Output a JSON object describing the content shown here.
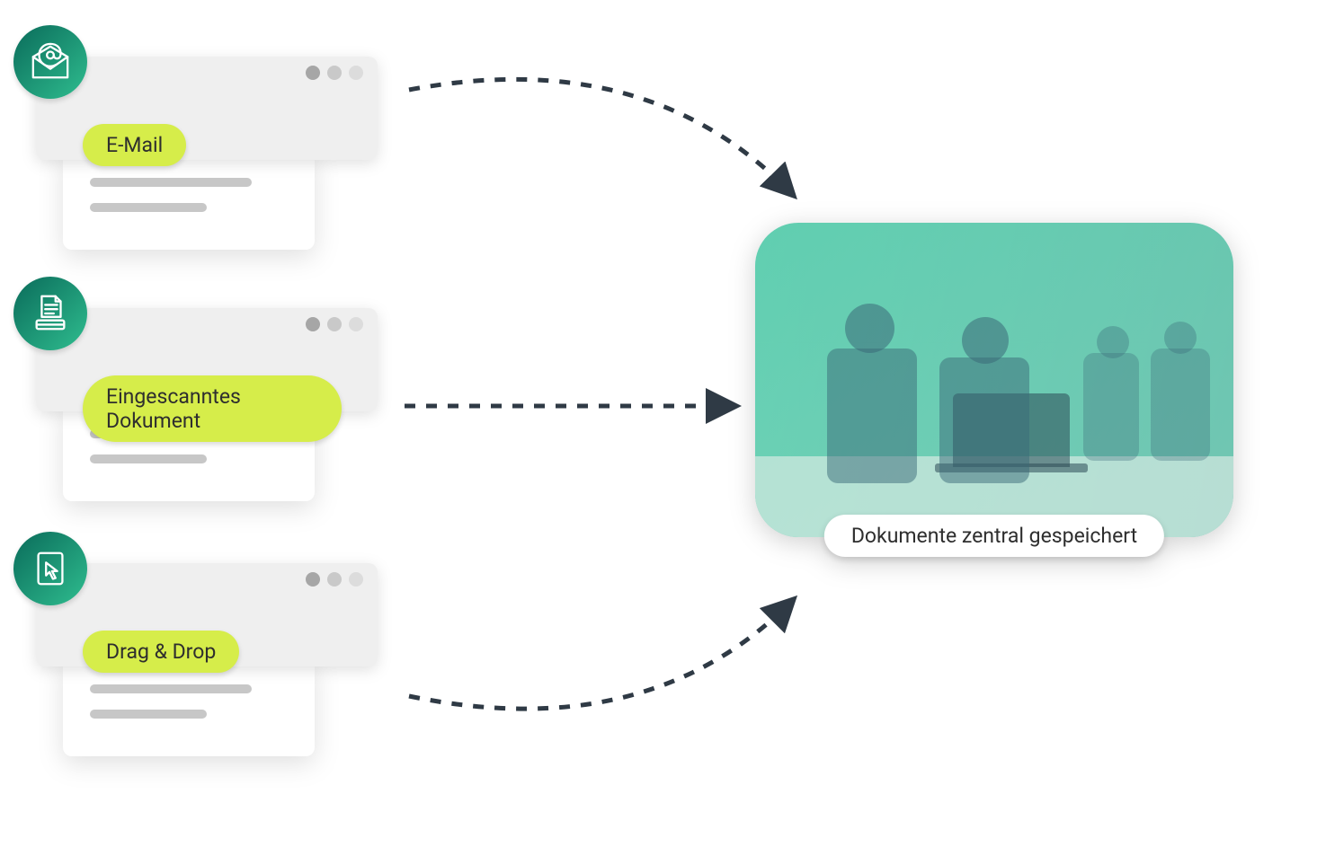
{
  "sources": [
    {
      "label": "E-Mail",
      "icon": "email-at-icon"
    },
    {
      "label": "Eingescanntes Dokument",
      "icon": "scan-document-icon"
    },
    {
      "label": "Drag & Drop",
      "icon": "cursor-pointer-icon"
    }
  ],
  "destination": {
    "label": "Dokumente zentral gespeichert"
  },
  "colors": {
    "accent_pill": "#d6ed4a",
    "badge_gradient_from": "#0a6b5a",
    "badge_gradient_to": "#2fbd8f",
    "arrow": "#2f3a45"
  }
}
